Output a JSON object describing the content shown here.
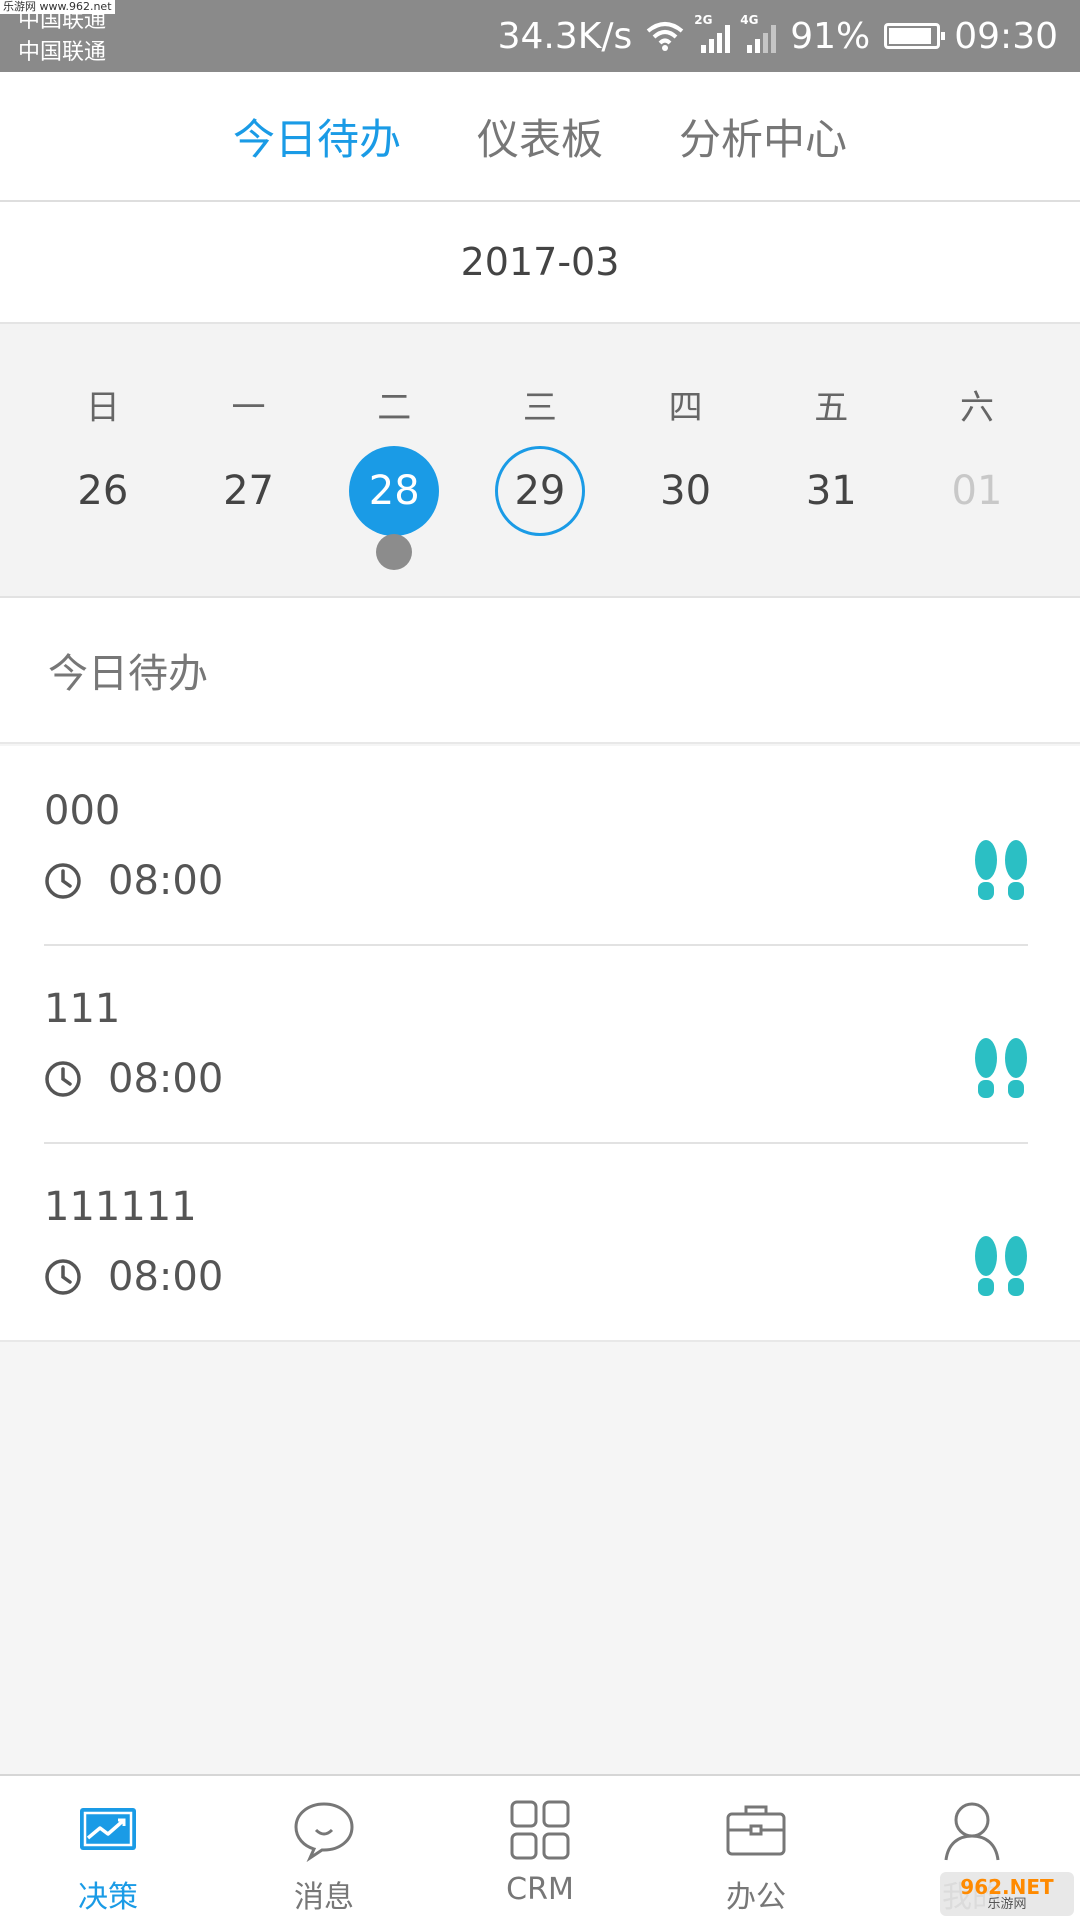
{
  "status_bar": {
    "carrier_1": "中国联通",
    "carrier_2": "中国联通",
    "watermark": "乐游网 www.962.net",
    "net_speed": "34.3K/s",
    "signal_1_tag": "2G",
    "signal_2_tag": "4G",
    "battery": "91%",
    "battery_level": 0.91,
    "time": "09:30"
  },
  "top_tabs": [
    {
      "label": "今日待办",
      "active": true
    },
    {
      "label": "仪表板",
      "active": false
    },
    {
      "label": "分析中心",
      "active": false
    }
  ],
  "calendar": {
    "month": "2017-03",
    "weekdays": [
      "日",
      "一",
      "二",
      "三",
      "四",
      "五",
      "六"
    ],
    "days": [
      {
        "label": "26",
        "state": "normal"
      },
      {
        "label": "27",
        "state": "normal"
      },
      {
        "label": "28",
        "state": "selected",
        "has_event": true
      },
      {
        "label": "29",
        "state": "today"
      },
      {
        "label": "30",
        "state": "normal"
      },
      {
        "label": "31",
        "state": "normal"
      },
      {
        "label": "01",
        "state": "muted"
      }
    ],
    "accent_color": "#1a9be6"
  },
  "section": {
    "title": "今日待办"
  },
  "tasks": [
    {
      "title": "000",
      "time": "08:00",
      "icon": "footprints-icon"
    },
    {
      "title": "111",
      "time": "08:00",
      "icon": "footprints-icon"
    },
    {
      "title": "111111",
      "time": "08:00",
      "icon": "footprints-icon"
    }
  ],
  "footprint_color": "#2bbfc4",
  "bottom_nav": [
    {
      "label": "决策",
      "icon": "chart-icon",
      "active": true
    },
    {
      "label": "消息",
      "icon": "chat-icon",
      "active": false
    },
    {
      "label": "CRM",
      "icon": "grid-icon",
      "active": false
    },
    {
      "label": "办公",
      "icon": "briefcase-icon",
      "active": false
    },
    {
      "label": "我的",
      "icon": "person-icon",
      "active": false
    }
  ],
  "logo": {
    "line1": "962.NET",
    "line2": "乐游网"
  }
}
